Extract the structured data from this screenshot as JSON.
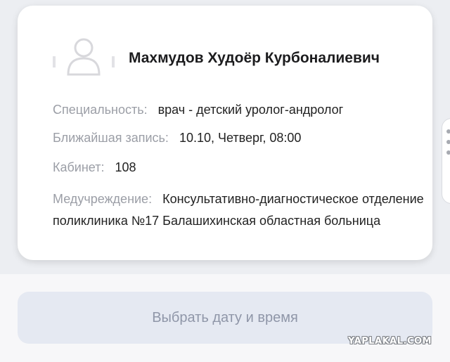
{
  "doctor": {
    "name": "Махмудов Худоёр Курбоналиевич",
    "specialty_label": "Специальность:",
    "specialty_value": "врач - детский уролог-андролог",
    "nearest_label": "Ближайшая запись:",
    "nearest_value": "10.10, Четверг, 08:00",
    "cabinet_label": "Кабинет:",
    "cabinet_value": "108",
    "institution_label": "Медучреждение:",
    "institution_value": "Консультативно-диагностическое отделение поликлиника №17 Балашихинская областная больница"
  },
  "action": {
    "select_datetime": "Выбрать дату и время"
  },
  "watermark": {
    "text": "YAPLAKAL.COM"
  },
  "icons": {
    "avatar": "user-placeholder-icon",
    "side_handle": "more-vertical-icon"
  },
  "colors": {
    "card_bg": "#ffffff",
    "label": "#9b9ea6",
    "value": "#222222",
    "button_bg": "#e5e9f2",
    "button_text": "#8f96a8"
  }
}
